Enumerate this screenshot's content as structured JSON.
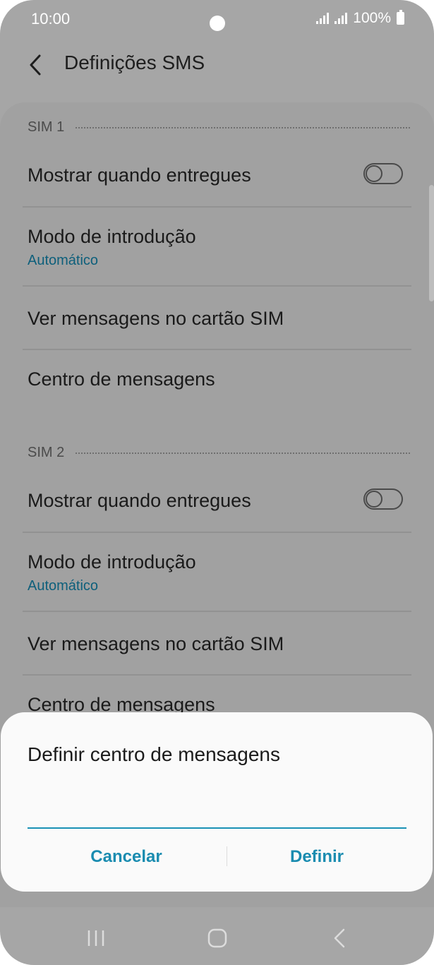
{
  "status_bar": {
    "time": "10:00",
    "battery": "100%"
  },
  "header": {
    "title": "Definições SMS"
  },
  "sim1": {
    "section_label": "SIM 1",
    "delivery_label": "Mostrar quando entregues",
    "delivery_on": false,
    "input_mode_label": "Modo de introdução",
    "input_mode_value": "Automático",
    "view_sim_label": "Ver mensagens no cartão SIM",
    "message_center_label": "Centro de mensagens"
  },
  "sim2": {
    "section_label": "SIM 2",
    "delivery_label": "Mostrar quando entregues",
    "delivery_on": false,
    "input_mode_label": "Modo de introdução",
    "input_mode_value": "Automático",
    "view_sim_label": "Ver mensagens no cartão SIM",
    "message_center_label": "Centro de mensagens"
  },
  "dialog": {
    "title": "Definir centro de mensagens",
    "input_value": "",
    "cancel_label": "Cancelar",
    "confirm_label": "Definir"
  },
  "colors": {
    "accent": "#1a8cb0",
    "subtext": "#0d5f7b",
    "scrim_background": "#a6a6a6",
    "dialog_background": "#fafafa"
  },
  "icons": {
    "back": "chevron-left-icon",
    "nav_recents": "recents-icon",
    "nav_home": "home-icon",
    "nav_back": "back-icon"
  }
}
